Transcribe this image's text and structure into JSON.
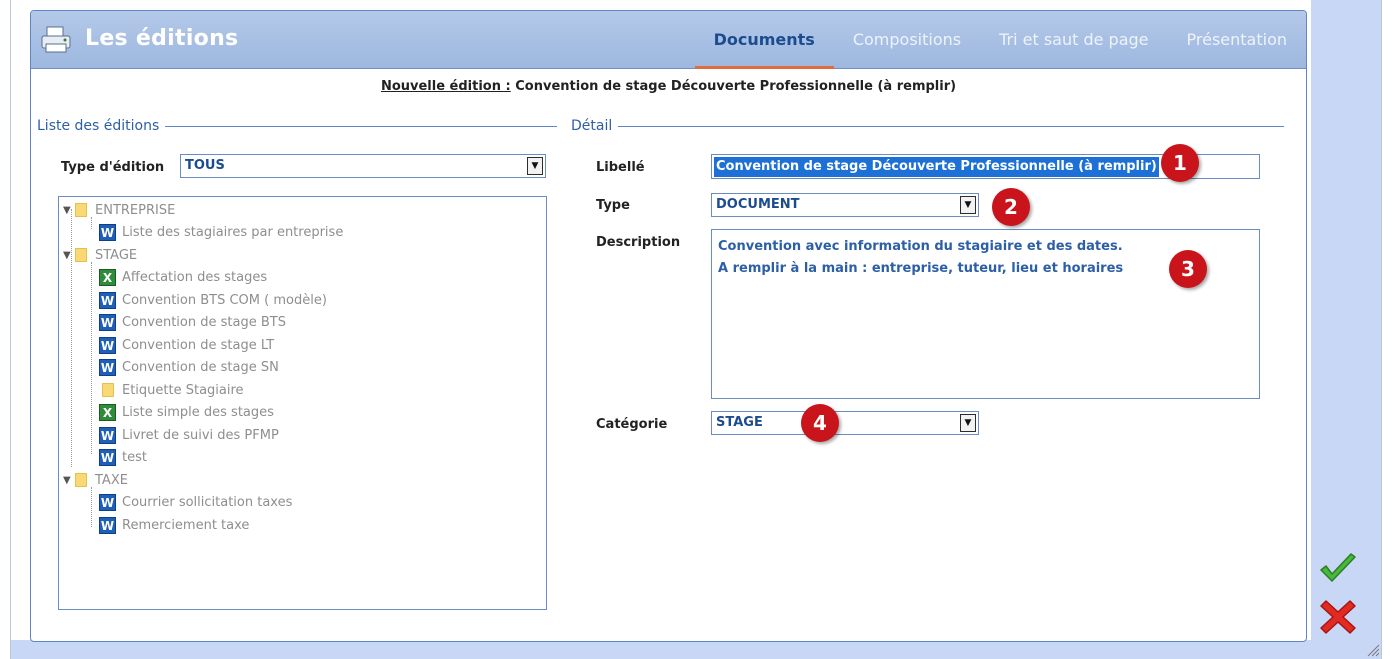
{
  "header": {
    "title": "Les éditions",
    "tabs": [
      {
        "label": "Documents",
        "active": true
      },
      {
        "label": "Compositions",
        "active": false
      },
      {
        "label": "Tri et saut de page",
        "active": false
      },
      {
        "label": "Présentation",
        "active": false
      }
    ]
  },
  "edition_title": {
    "prefix": "Nouvelle édition :",
    "name": "Convention de stage Découverte Professionnelle (à remplir)"
  },
  "left": {
    "section_label": "Liste des éditions",
    "type_label": "Type d'édition",
    "type_value": "TOUS",
    "tree": [
      {
        "kind": "folder",
        "label": "ENTREPRISE"
      },
      {
        "kind": "word",
        "label": "Liste des stagiaires par entreprise"
      },
      {
        "kind": "folder",
        "label": "STAGE"
      },
      {
        "kind": "excel",
        "label": "Affectation des stages"
      },
      {
        "kind": "word",
        "label": "Convention BTS COM ( modèle)"
      },
      {
        "kind": "word",
        "label": "Convention de stage BTS"
      },
      {
        "kind": "word",
        "label": "Convention de stage LT"
      },
      {
        "kind": "word",
        "label": "Convention de stage SN"
      },
      {
        "kind": "file",
        "label": "Etiquette Stagiaire"
      },
      {
        "kind": "excel",
        "label": "Liste simple des stages"
      },
      {
        "kind": "word",
        "label": "Livret de suivi des PFMP"
      },
      {
        "kind": "word",
        "label": "test"
      },
      {
        "kind": "folder",
        "label": "TAXE"
      },
      {
        "kind": "word",
        "label": "Courrier sollicitation taxes"
      },
      {
        "kind": "word",
        "label": "Remerciement taxe"
      }
    ]
  },
  "detail": {
    "section_label": "Détail",
    "libelle_label": "Libellé",
    "libelle_value": "Convention de stage Découverte Professionnelle (à remplir)",
    "type_label": "Type",
    "type_value": "DOCUMENT",
    "description_label": "Description",
    "description_line1": "Convention avec information du stagiaire et des dates.",
    "description_line2": "A remplir à la main : entreprise, tuteur, lieu et horaires",
    "categorie_label": "Catégorie",
    "categorie_value": "STAGE"
  },
  "badges": [
    "1",
    "2",
    "3",
    "4"
  ],
  "icons": {
    "header": "printer-icon",
    "validate": "check-icon",
    "cancel": "close-icon",
    "resize": "resize-grip-icon"
  },
  "colors": {
    "header_bg": "#9db7df",
    "accent_blue": "#1d4c8e",
    "active_tab_underline": "#e06b3c",
    "badge_red": "#c8141a"
  }
}
